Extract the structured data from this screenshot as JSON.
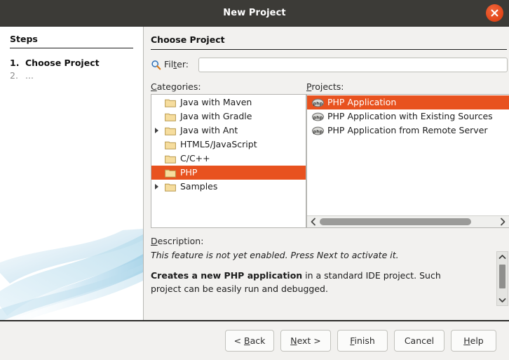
{
  "window": {
    "title": "New Project",
    "close_icon": "close-icon",
    "accent_color": "#e8491d",
    "titlebar_color": "#3c3b37"
  },
  "steps": {
    "heading": "Steps",
    "items": [
      {
        "number": "1.",
        "label": "Choose Project",
        "active": true
      },
      {
        "number": "2.",
        "label": "...",
        "active": false
      }
    ]
  },
  "main": {
    "pane_title": "Choose Project",
    "filter": {
      "icon": "search-icon",
      "label_pre": "Fil",
      "label_mnemonic": "t",
      "label_post": "er:",
      "value": "",
      "placeholder": ""
    },
    "categories": {
      "label_mnemonic": "C",
      "label_rest": "ategories:",
      "items": [
        {
          "label": "Java with Maven",
          "icon": "folder-icon",
          "expandable": false,
          "selected": false
        },
        {
          "label": "Java with Gradle",
          "icon": "folder-icon",
          "expandable": false,
          "selected": false
        },
        {
          "label": "Java with Ant",
          "icon": "folder-icon",
          "expandable": true,
          "selected": false
        },
        {
          "label": "HTML5/JavaScript",
          "icon": "folder-icon",
          "expandable": false,
          "selected": false
        },
        {
          "label": "C/C++",
          "icon": "folder-icon",
          "expandable": false,
          "selected": false
        },
        {
          "label": "PHP",
          "icon": "folder-icon",
          "expandable": false,
          "selected": true
        },
        {
          "label": "Samples",
          "icon": "folder-icon",
          "expandable": true,
          "selected": false
        }
      ]
    },
    "projects": {
      "label_mnemonic": "P",
      "label_rest": "rojects:",
      "items": [
        {
          "label": "PHP Application",
          "icon": "php-icon",
          "selected": true
        },
        {
          "label": "PHP Application with Existing Sources",
          "icon": "php-icon",
          "selected": false
        },
        {
          "label": "PHP Application from Remote Server",
          "icon": "php-icon",
          "selected": false
        }
      ],
      "hscroll": {
        "left_arrow": "chevron-left-icon",
        "right_arrow": "chevron-right-icon"
      }
    },
    "description": {
      "label_mnemonic": "D",
      "label_rest": "escription:",
      "line1": "This feature is not yet enabled. Press Next to activate it.",
      "line2_bold": "Creates a new PHP application",
      "line2_rest": " in a standard IDE project. Such",
      "line3": "project can be easily run and debugged.",
      "vscroll": {
        "up_arrow": "chevron-up-icon",
        "down_arrow": "chevron-down-icon"
      }
    },
    "selection_color": "#e8521f"
  },
  "buttons": {
    "back": {
      "pre": "< ",
      "mnemonic": "B",
      "post": "ack"
    },
    "next": {
      "pre": "",
      "mnemonic": "N",
      "post": "ext >"
    },
    "finish": {
      "pre": "",
      "mnemonic": "F",
      "post": "inish"
    },
    "cancel": {
      "pre": "",
      "mnemonic": "",
      "post": "Cancel"
    },
    "help": {
      "pre": "",
      "mnemonic": "H",
      "post": "elp"
    }
  }
}
